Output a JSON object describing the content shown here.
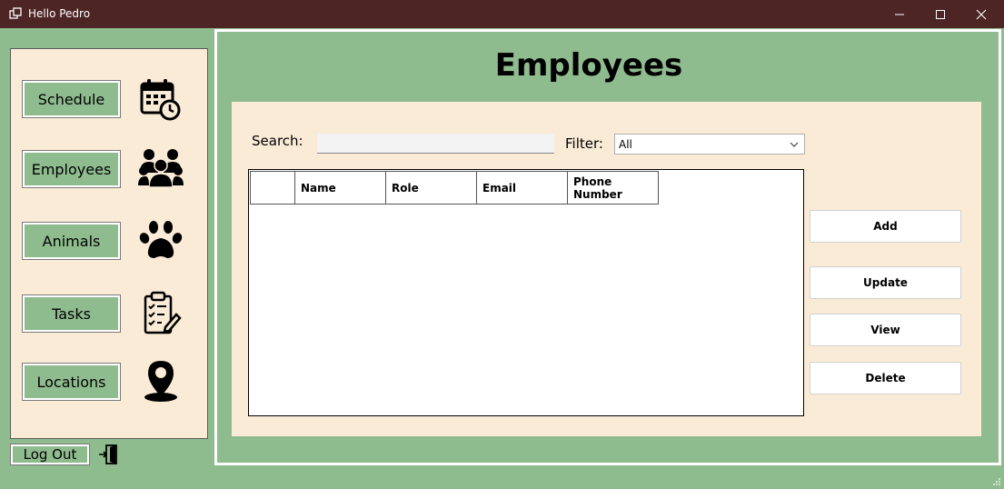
{
  "window": {
    "title": "Hello Pedro"
  },
  "sidebar": {
    "items": [
      {
        "label": "Schedule",
        "icon": "calendar-clock-icon"
      },
      {
        "label": "Employees",
        "icon": "people-group-icon"
      },
      {
        "label": "Animals",
        "icon": "paw-icon"
      },
      {
        "label": "Tasks",
        "icon": "clipboard-checklist-icon"
      },
      {
        "label": "Locations",
        "icon": "map-pin-icon"
      }
    ],
    "logout_label": "Log Out"
  },
  "main": {
    "title": "Employees",
    "search": {
      "label": "Search:",
      "value": ""
    },
    "filter": {
      "label": "Filter:",
      "selected": "All"
    },
    "table": {
      "columns": [
        "",
        "Name",
        "Role",
        "Email",
        "Phone Number"
      ],
      "rows": []
    },
    "actions": {
      "add": "Add",
      "update": "Update",
      "view": "View",
      "delete": "Delete"
    }
  },
  "colors": {
    "titlebar": "#4e2525",
    "background": "#8fbc8f",
    "panel": "#faebd7"
  }
}
